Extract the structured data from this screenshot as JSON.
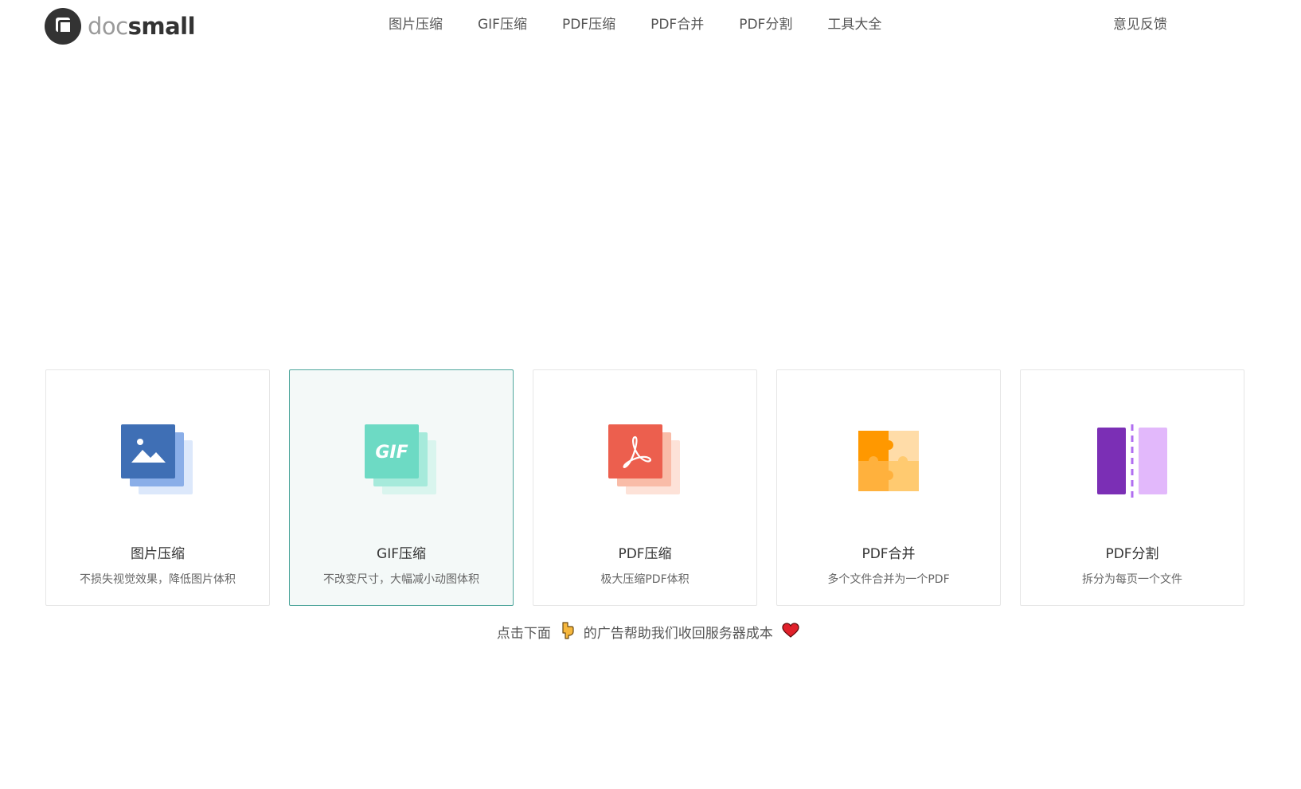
{
  "header": {
    "logo_doc": "doc",
    "logo_small": "small",
    "nav": [
      {
        "label": "图片压缩"
      },
      {
        "label": "GIF压缩"
      },
      {
        "label": "PDF压缩"
      },
      {
        "label": "PDF合并"
      },
      {
        "label": "PDF分割"
      },
      {
        "label": "工具大全"
      }
    ],
    "feedback_label": "意见反馈"
  },
  "cards": [
    {
      "title": "图片压缩",
      "desc": "不损失视觉效果，降低图片体积",
      "icon": "image-icon",
      "color": "#3f6fb5",
      "active": false
    },
    {
      "title": "GIF压缩",
      "desc": "不改变尺寸，大幅减小动图体积",
      "icon": "gif-icon",
      "icon_text": "GIF",
      "color": "#6ddac4",
      "active": true
    },
    {
      "title": "PDF压缩",
      "desc": "极大压缩PDF体积",
      "icon": "pdf-icon",
      "color": "#ec5f4e",
      "active": false
    },
    {
      "title": "PDF合并",
      "desc": "多个文件合并为一个PDF",
      "icon": "puzzle-icon",
      "color": "#ffa52d",
      "active": false
    },
    {
      "title": "PDF分割",
      "desc": "拆分为每页一个文件",
      "icon": "split-icon",
      "color": "#7b2fb5",
      "active": false
    }
  ],
  "ad_note": {
    "before": "点击下面",
    "after": "的广告帮助我们收回服务器成本",
    "pointer_icon": "pointing-down-icon",
    "heart_icon": "heart-icon"
  },
  "colors": {
    "active_border": "#4fa69c",
    "active_bg": "#f4f9f8"
  }
}
